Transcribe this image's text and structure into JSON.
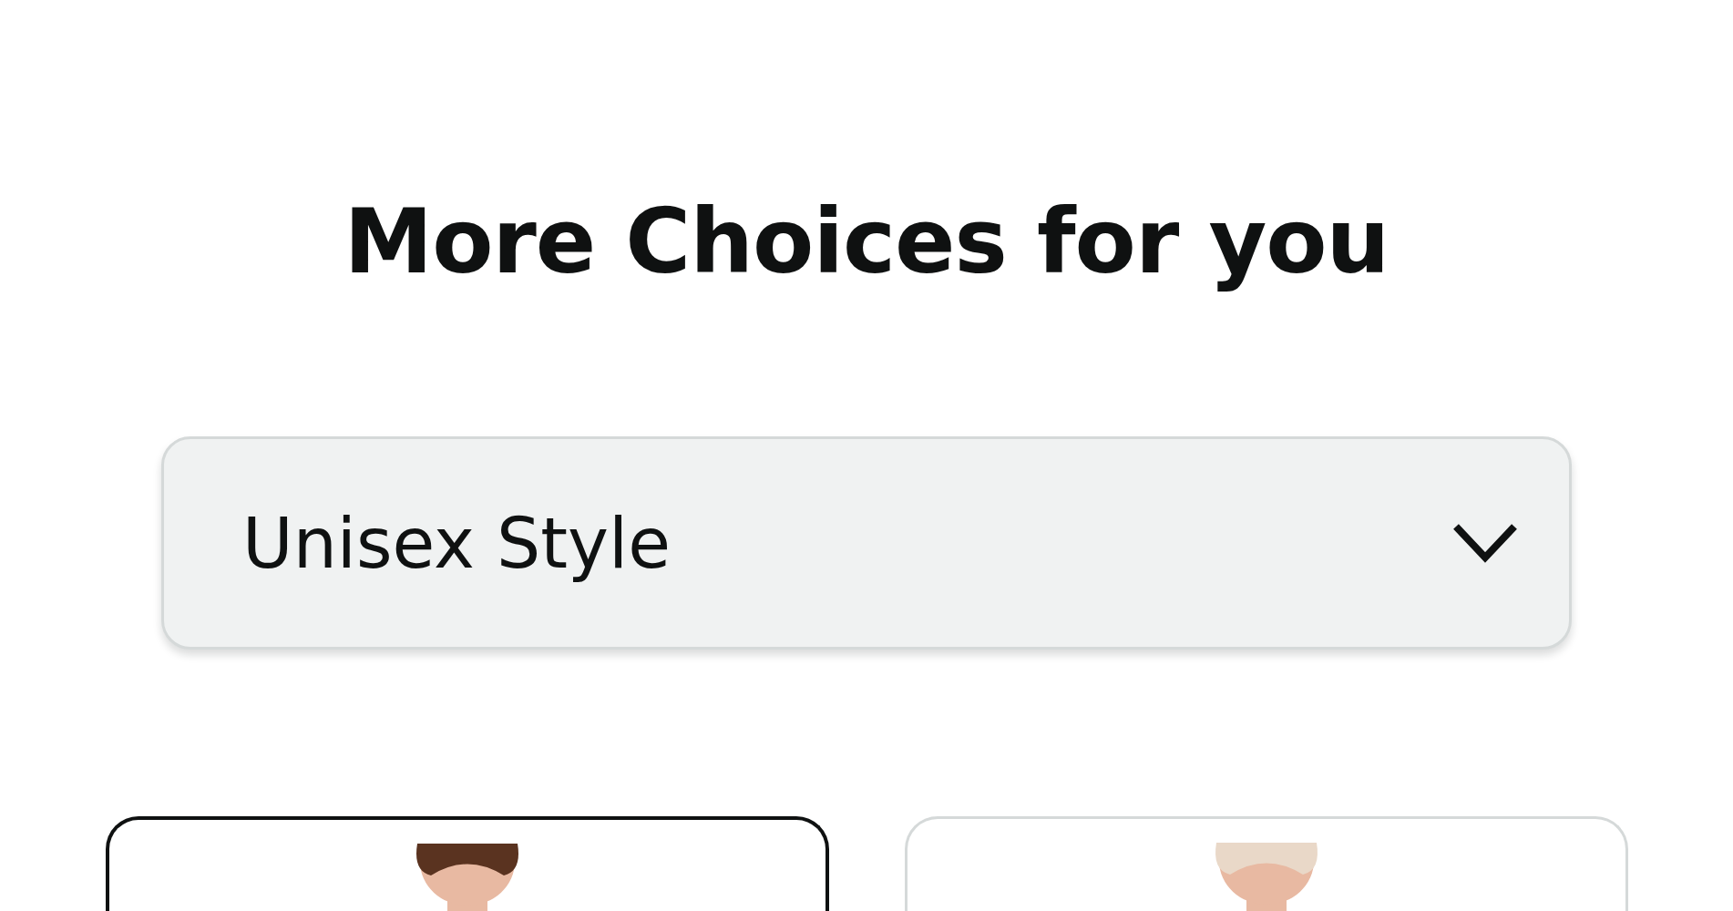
{
  "heading": "More Choices for you",
  "dropdown": {
    "value": "Unisex Style"
  },
  "products": [
    {
      "kind": "picture",
      "selected": true
    },
    {
      "kind": "picture",
      "selected": false
    }
  ]
}
